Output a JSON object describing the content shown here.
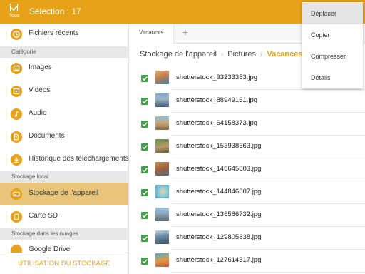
{
  "header": {
    "select_all_label": "Tous",
    "selection_title": "Sélection : 17"
  },
  "sidebar": {
    "recent": "Fichiers récents",
    "category_header": "Catégorie",
    "categories": [
      "Images",
      "Vidéos",
      "Audio",
      "Documents",
      "Historique des téléchargements"
    ],
    "local_header": "Stockage local",
    "local": [
      "Stockage de l'appareil",
      "Carte SD"
    ],
    "cloud_header": "Stockage dans les nuages",
    "cloud": [
      "Google Drive"
    ],
    "storage_usage": "UTILISATION DU STOCKAGE"
  },
  "tabs": {
    "active": "Vacances",
    "add": "+"
  },
  "breadcrumb": {
    "items": [
      "Stockage de l'appareil",
      "Pictures"
    ],
    "current": "Vacances",
    "separator": "›"
  },
  "files": [
    "shutterstock_93233353.jpg",
    "shutterstock_88949161.jpg",
    "shutterstock_64158373.jpg",
    "shutterstock_153938663.jpg",
    "shutterstock_146645603.jpg",
    "shutterstock_144846607.jpg",
    "shutterstock_136586732.jpg",
    "shutterstock_129805838.jpg",
    "shutterstock_127614317.jpg"
  ],
  "context_menu": [
    "Déplacer",
    "Copier",
    "Compresser",
    "Détails"
  ],
  "colors": {
    "accent": "#e8a21a",
    "active_row": "#e9c47b",
    "checkbox": "#43a046"
  }
}
